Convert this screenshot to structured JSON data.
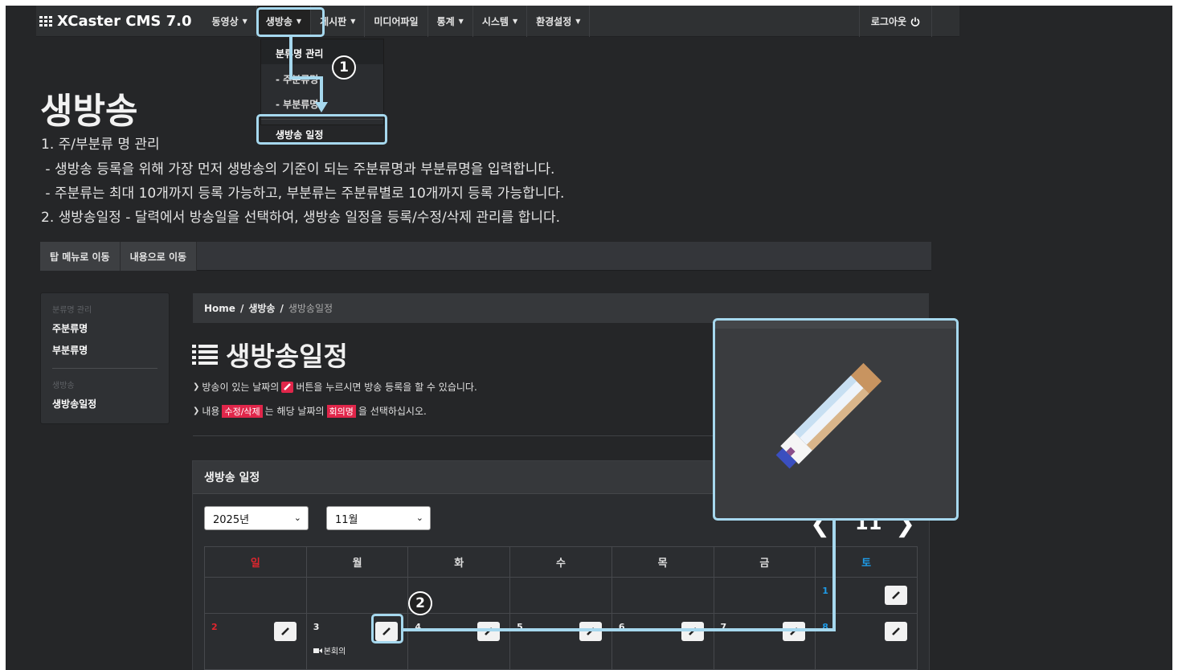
{
  "app": {
    "title": "XCaster CMS 7.0"
  },
  "nav": {
    "items": [
      {
        "label": "동영상",
        "caret": "▼"
      },
      {
        "label": "생방송",
        "caret": "▼"
      },
      {
        "label": "게시판",
        "caret": "▼"
      },
      {
        "label": "미디어파일",
        "caret": ""
      },
      {
        "label": "통계",
        "caret": "▼"
      },
      {
        "label": "시스템",
        "caret": "▼"
      },
      {
        "label": "환경설정",
        "caret": "▼"
      }
    ],
    "logout": "로그아웃",
    "active_index": 1
  },
  "dropdown": {
    "header": "분류명 관리",
    "items": [
      "- 주분류명",
      "- 부분류명"
    ],
    "schedule": "생방송 일정"
  },
  "callouts": {
    "one": "1",
    "two": "2"
  },
  "page": {
    "title": "생방송",
    "lines": [
      "1. 주/부분류 명 관리",
      " - 생방송 등록을 위해 가장 먼저 생방송의 기준이 되는 주분류명과 부분류명을 입력합니다.",
      " - 주분류는 최대 10개까지 등록 가능하고, 부분류는 주분류별로 10개까지 등록 가능합니다.",
      "2. 생방송일정 - 달력에서 방송일을 선택하여, 생방송 일정을 등록/수정/삭제 관리를 합니다."
    ]
  },
  "skip": {
    "top": "탑 메뉴로 이동",
    "content": "내용으로 이동"
  },
  "sidebar": {
    "cap1": "분류명 관리",
    "link1": "주분류명",
    "link2": "부분류명",
    "cap2": "생방송",
    "link3": "생방송일정"
  },
  "breadcrumb": {
    "home": "Home",
    "sep": "/",
    "section": "생방송",
    "current": "생방송일정"
  },
  "content": {
    "heading": "생방송일정",
    "hint1_a": "방송이 있는 날짜의",
    "hint1_b": "버튼을 누르시면 방송 등록을 할 수 있습니다.",
    "hint2_a": "내용",
    "hint2_pill1": "수정/삭제",
    "hint2_b": "는 해당 날짜의",
    "hint2_pill2": "회의명",
    "hint2_c": "을 선택하십시오."
  },
  "panel": {
    "title": "생방송 일정",
    "year": "2025년",
    "month": "11월",
    "calendar_label": "11",
    "weekdays": [
      "일",
      "월",
      "화",
      "수",
      "목",
      "금",
      "토"
    ],
    "row1": {
      "sat": "1"
    },
    "row2": {
      "sun": "2",
      "mon": "3",
      "tue": "4",
      "wed": "5",
      "thu": "6",
      "fri": "7",
      "sat": "8"
    },
    "event": "본회의"
  },
  "colors": {
    "accent": "#a6d8ee",
    "sunday": "#e0262e",
    "saturday": "#1e9be8",
    "pill": "#e0264a"
  }
}
